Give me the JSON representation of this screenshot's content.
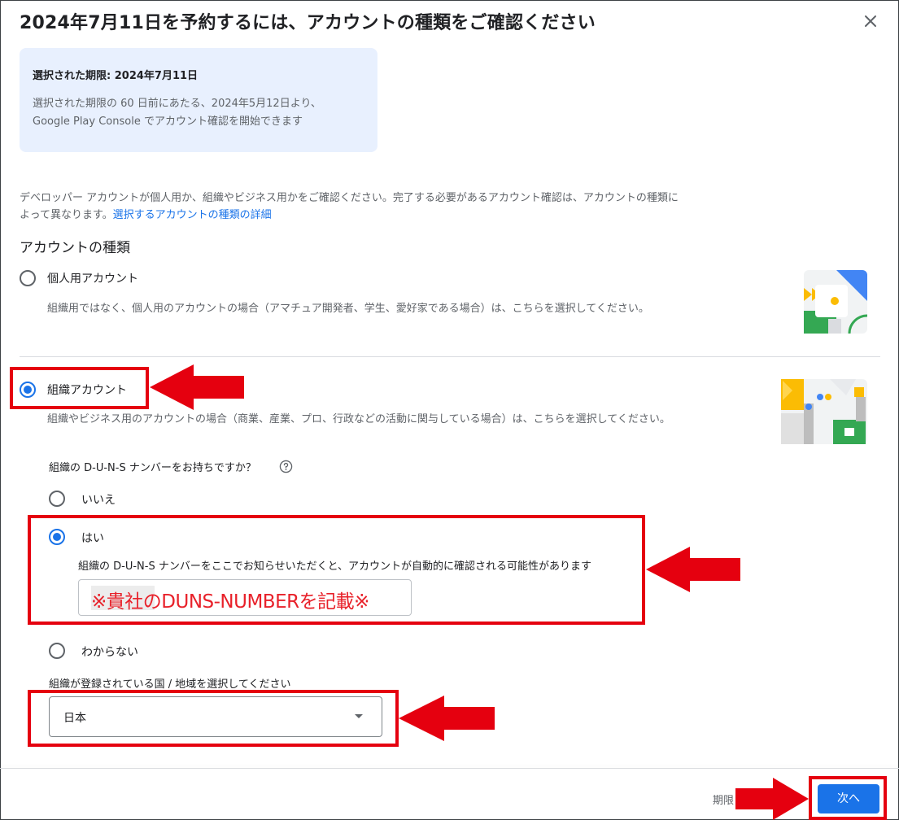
{
  "dialog": {
    "title": "2024年7月11日を予約するには、アカウントの種類をご確認ください",
    "close_icon": "close-icon"
  },
  "info": {
    "heading": "選択された期限: 2024年7月11日",
    "body_line1": "選択された期限の 60 日前にあたる、2024年5月12日より、",
    "body_line2": "Google Play Console でアカウント確認を開始できます"
  },
  "description": {
    "line1": "デベロッパー アカウントが個人用か、組織やビジネス用かをご確認ください。完了する必要があるアカウント確認は、アカウントの種類に",
    "line2_prefix": "よって異なります。",
    "link": "選択するアカウントの種類の詳細"
  },
  "account_type": {
    "heading": "アカウントの種類",
    "personal": {
      "label": "個人用アカウント",
      "desc": "組織用ではなく、個人用のアカウントの場合（アマチュア開発者、学生、愛好家である場合）は、こちらを選択してください。",
      "selected": false
    },
    "organization": {
      "label": "組織アカウント",
      "desc": "組織やビジネス用のアカウントの場合（商業、産業、プロ、行政などの活動に関与している場合）は、こちらを選択してください。",
      "selected": true
    }
  },
  "duns": {
    "question": "組織の D-U-N-S ナンバーをお持ちですか？",
    "help_icon": "help-circle-icon",
    "options": {
      "no": "いいえ",
      "yes": "はい",
      "unknown": "わからない"
    },
    "selected": "yes",
    "yes_desc": "組織の D-U-N-S ナンバーをここでお知らせいただくと、アカウントが自動的に確認される可能性があります",
    "input_value": "※貴社のDUNS-NUMBERを記載※"
  },
  "country": {
    "label": "組織が登録されている国 / 地域を選択してください",
    "value": "日本"
  },
  "footer": {
    "partial_text": "期限",
    "next_label": "次へ"
  },
  "colors": {
    "accent": "#1a73e8",
    "annotation_red": "#e5000f",
    "info_bg": "#e8f0fe"
  }
}
